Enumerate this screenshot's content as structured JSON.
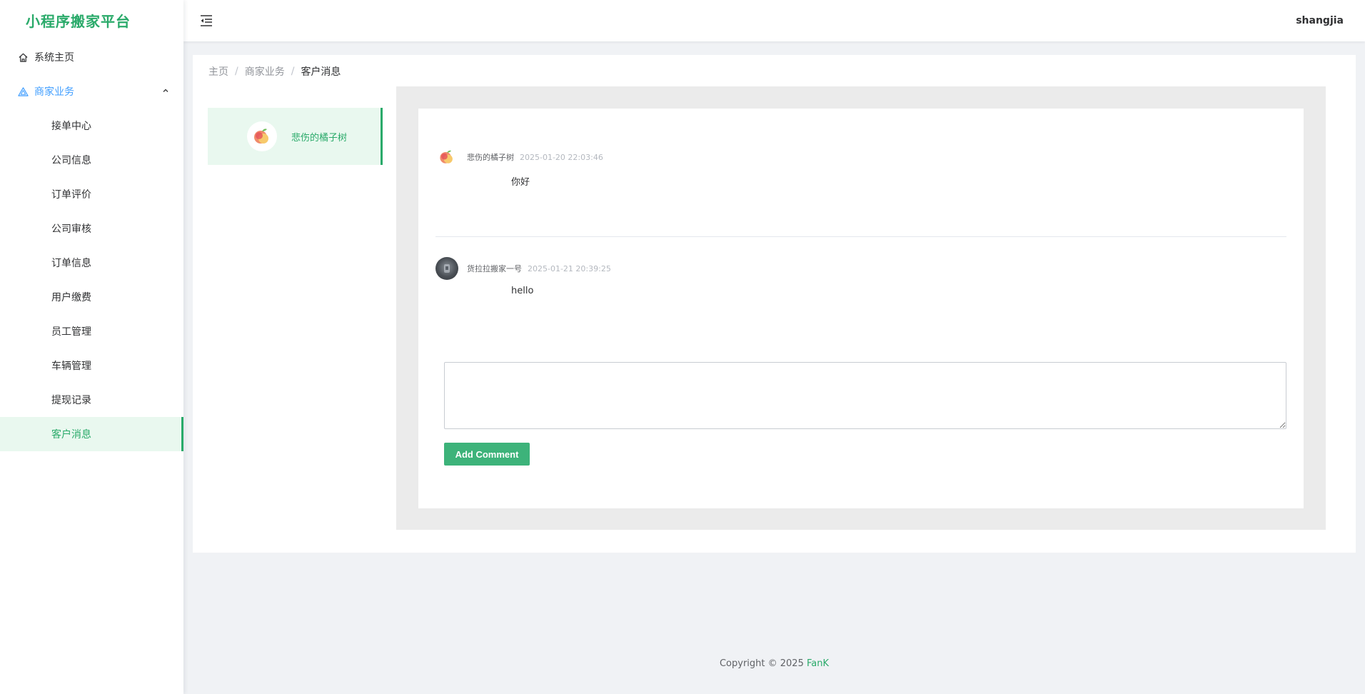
{
  "app": {
    "title": "小程序搬家平台"
  },
  "header": {
    "username": "shangjia"
  },
  "sidebar": {
    "home": "系统主页",
    "group": "商家业务",
    "items": [
      {
        "label": "接单中心"
      },
      {
        "label": "公司信息"
      },
      {
        "label": "订单评价"
      },
      {
        "label": "公司审核"
      },
      {
        "label": "订单信息"
      },
      {
        "label": "用户缴费"
      },
      {
        "label": "员工管理"
      },
      {
        "label": "车辆管理"
      },
      {
        "label": "提现记录"
      },
      {
        "label": "客户消息"
      }
    ]
  },
  "breadcrumb": {
    "home": "主页",
    "section": "商家业务",
    "current": "客户消息",
    "separator": "/"
  },
  "contacts": [
    {
      "name": "悲伤的橘子树",
      "icon": "peach-avatar-icon"
    }
  ],
  "messages": [
    {
      "user": "悲伤的橘子树",
      "time": "2025-01-20 22:03:46",
      "text": "你好",
      "avatar": "peach-avatar-icon"
    },
    {
      "user": "货拉拉搬家一号",
      "time": "2025-01-21 20:39:25",
      "text": "hello",
      "avatar": "photo-avatar-icon"
    }
  ],
  "composer": {
    "placeholder": "",
    "button_label": "Add Comment"
  },
  "footer": {
    "text": "Copyright © 2025",
    "brand": "FanK"
  },
  "colors": {
    "accent": "#2aaa6a",
    "menu_group": "#409eff",
    "button": "#3db37a"
  }
}
